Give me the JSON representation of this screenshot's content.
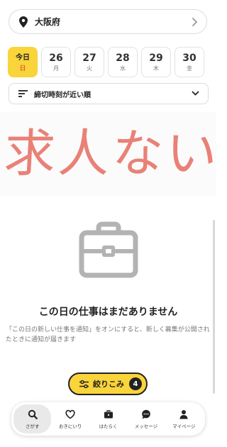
{
  "location": {
    "text": "大阪府",
    "icon": "location-pin-icon"
  },
  "dates": [
    {
      "num": "今日",
      "dow": "日",
      "active": true
    },
    {
      "num": "26",
      "dow": "月",
      "active": false
    },
    {
      "num": "27",
      "dow": "火",
      "active": false
    },
    {
      "num": "28",
      "dow": "水",
      "active": false
    },
    {
      "num": "29",
      "dow": "木",
      "active": false
    },
    {
      "num": "30",
      "dow": "金",
      "active": false
    }
  ],
  "sort": {
    "label": "締切時刻が近い順",
    "icon": "sort-icon"
  },
  "overlay": {
    "text": "求人ない"
  },
  "empty": {
    "icon": "briefcase-icon",
    "title": "この日の仕事はまだありません",
    "description": "「この日の新しい仕事を通知」をオンにすると、新しく募集が公開されたときに通知が届きます"
  },
  "filter": {
    "label": "絞りこみ",
    "count": "4",
    "icon": "filter-sliders-icon"
  },
  "tabs": [
    {
      "label": "さがす",
      "icon": "search-icon",
      "active": true
    },
    {
      "label": "おきにいり",
      "icon": "heart-icon",
      "active": false
    },
    {
      "label": "はたらく",
      "icon": "briefcase-icon",
      "active": false
    },
    {
      "label": "メッセージ",
      "icon": "chat-icon",
      "active": false
    },
    {
      "label": "マイページ",
      "icon": "person-icon",
      "active": false
    }
  ],
  "colors": {
    "accent": "#f9d43a",
    "today": "#d33b2b",
    "overlay_ink": "#e8776c"
  }
}
